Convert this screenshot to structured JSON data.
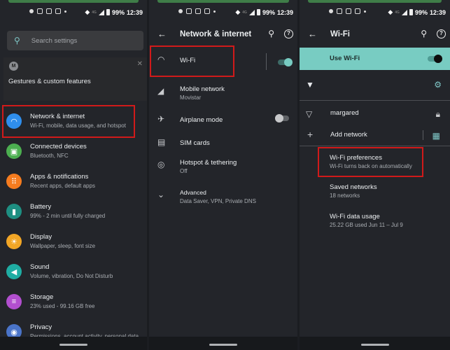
{
  "status_bar": {
    "battery": "99%",
    "time": "12:39",
    "network": "4G"
  },
  "panel1": {
    "search_placeholder": "Search settings",
    "card": {
      "title": "Gestures & custom features",
      "logo": "M",
      "close": "✕"
    },
    "items": [
      {
        "title": "Network & internet",
        "subtitle": "Wi-Fi, mobile, data usage, and hotspot",
        "icon": "wifi-icon",
        "color": "#2f8eec",
        "glyph": "◠"
      },
      {
        "title": "Connected devices",
        "subtitle": "Bluetooth, NFC",
        "icon": "devices-icon",
        "color": "#4caf50",
        "glyph": "▣"
      },
      {
        "title": "Apps & notifications",
        "subtitle": "Recent apps, default apps",
        "icon": "apps-icon",
        "color": "#f57c1f",
        "glyph": "⠿"
      },
      {
        "title": "Battery",
        "subtitle": "99% - 2 min until fully charged",
        "icon": "battery-icon",
        "color": "#1e8f82",
        "glyph": "▮"
      },
      {
        "title": "Display",
        "subtitle": "Wallpaper, sleep, font size",
        "icon": "display-icon",
        "color": "#f2a626",
        "glyph": "☀"
      },
      {
        "title": "Sound",
        "subtitle": "Volume, vibration, Do Not Disturb",
        "icon": "sound-icon",
        "color": "#1fada3",
        "glyph": "◀"
      },
      {
        "title": "Storage",
        "subtitle": "23% used - 99.16 GB free",
        "icon": "storage-icon",
        "color": "#b24fcf",
        "glyph": "≡"
      },
      {
        "title": "Privacy",
        "subtitle": "Permissions, account activity, personal data",
        "icon": "privacy-icon",
        "color": "#4a74c9",
        "glyph": "◉"
      }
    ]
  },
  "panel2": {
    "title": "Network & internet",
    "items": [
      {
        "title": "Wi-Fi",
        "subtitle": "",
        "glyph": "◠"
      },
      {
        "title": "Mobile network",
        "subtitle": "Movistar",
        "glyph": "◢"
      },
      {
        "title": "Airplane mode",
        "subtitle": "",
        "glyph": "✈"
      },
      {
        "title": "SIM cards",
        "subtitle": "",
        "glyph": "▤"
      },
      {
        "title": "Hotspot & tethering",
        "subtitle": "Off",
        "glyph": "◎"
      },
      {
        "title": "Advanced",
        "subtitle": "Data Saver, VPN, Private DNS",
        "glyph": "⌄"
      }
    ],
    "wifi_toggle_on": true,
    "airplane_toggle_on": false
  },
  "panel3": {
    "title": "Wi-Fi",
    "use_wifi_label": "Use Wi-Fi",
    "use_wifi_on": true,
    "network_saved": "margared",
    "add_network": "Add network",
    "prefs": [
      {
        "title": "Wi-Fi preferences",
        "subtitle": "Wi-Fi turns back on automatically"
      },
      {
        "title": "Saved networks",
        "subtitle": "18 networks"
      },
      {
        "title": "Wi-Fi data usage",
        "subtitle": "25.22 GB used Jun 11 – Jul 9"
      }
    ]
  }
}
